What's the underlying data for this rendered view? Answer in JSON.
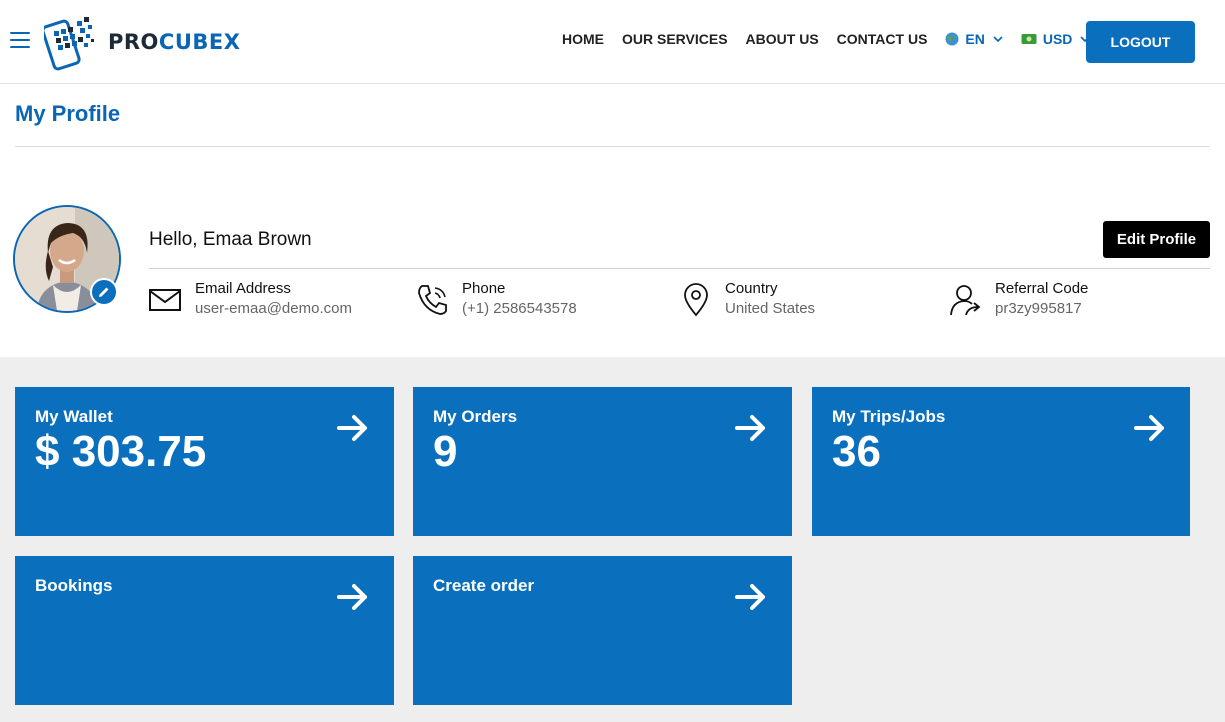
{
  "header": {
    "logo_part1": "PRO",
    "logo_part2": "CUBEX",
    "nav": [
      "HOME",
      "OUR SERVICES",
      "ABOUT US",
      "CONTACT US"
    ],
    "language": "EN",
    "currency": "USD",
    "logout_label": "LOGOUT"
  },
  "page": {
    "title": "My Profile"
  },
  "profile": {
    "greeting": "Hello, Emaa Brown",
    "edit_label": "Edit Profile",
    "email_label": "Email Address",
    "email_value": "user-emaa@demo.com",
    "phone_label": "Phone",
    "phone_value": "(+1) 2586543578",
    "country_label": "Country",
    "country_value": "United States",
    "referral_label": "Referral Code",
    "referral_value": "pr3zy995817"
  },
  "cards": {
    "wallet": {
      "title": "My Wallet",
      "value": "$ 303.75"
    },
    "orders": {
      "title": "My Orders",
      "value": "9"
    },
    "trips": {
      "title": "My Trips/Jobs",
      "value": "36"
    },
    "bookings": {
      "title": "Bookings"
    },
    "create": {
      "title": "Create order"
    }
  },
  "colors": {
    "brand": "#0a6fbd",
    "dark": "#1f2a37",
    "dashboard_bg": "#eeeeee"
  }
}
